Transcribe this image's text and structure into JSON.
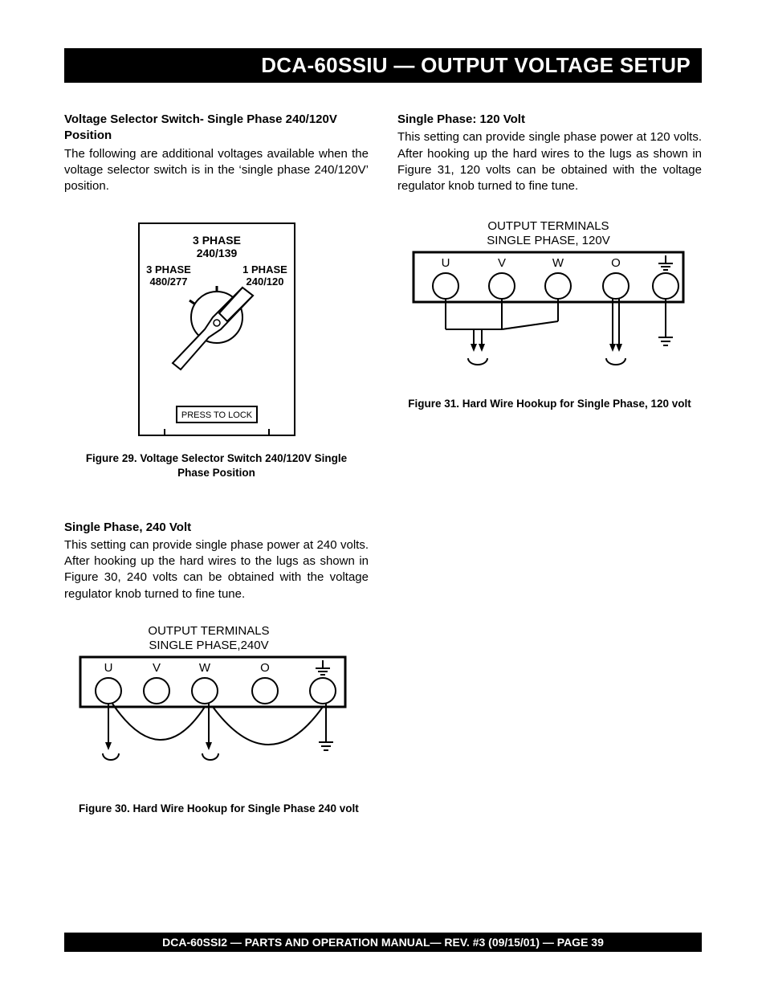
{
  "title_bar": "DCA-60SSIU — OUTPUT VOLTAGE SETUP",
  "left": {
    "sec1_h": "Voltage Selector Switch- Single Phase  240/120V Position",
    "sec1_p": "The following are additional voltages available when the voltage selector switch is in the ‘single phase 240/120V’ position.",
    "fig29": {
      "label_top": "3 PHASE",
      "label_top2": "240/139",
      "label_left1": "3 PHASE",
      "label_left2": "480/277",
      "label_right1": "1 PHASE",
      "label_right2": "240/120",
      "press": "PRESS TO LOCK",
      "caption": "Figure 29.  Voltage Selector Switch 240/120V Single Phase Position"
    },
    "sec2_h": "Single Phase, 240 Volt",
    "sec2_p": "This setting can provide single phase power at 240 volts. After hooking up the hard wires to the lugs as shown in Figure 30, 240 volts can be obtained with the voltage regulator knob turned to fine tune.",
    "fig30": {
      "title1": "OUTPUT TERMINALS",
      "title2": "SINGLE PHASE,240V",
      "U": "U",
      "V": "V",
      "W": "W",
      "O": "O",
      "caption": "Figure 30.  Hard Wire Hookup for Single Phase 240 volt"
    }
  },
  "right": {
    "sec1_h": "Single Phase: 120 Volt",
    "sec1_p": "This setting can provide single phase power at 120 volts. After hooking up the hard wires to the lugs as shown in Figure 31, 120 volts can be obtained with the voltage regulator knob turned to fine tune.",
    "fig31": {
      "title1": "OUTPUT TERMINALS",
      "title2": "SINGLE PHASE, 120V",
      "U": "U",
      "V": "V",
      "W": "W",
      "O": "O",
      "caption": "Figure 31.  Hard Wire Hookup for Single Phase, 120 volt"
    }
  },
  "footer": "DCA-60SSI2 — PARTS AND OPERATION  MANUAL— REV. #3  (09/15/01) — PAGE 39"
}
